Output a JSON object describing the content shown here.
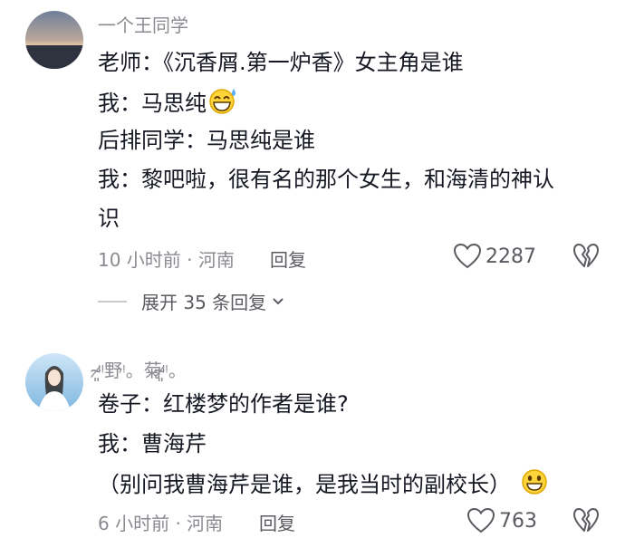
{
  "comments": [
    {
      "username": "一个王同学",
      "lines": [
        "老师：《沉香屑.第一炉香》女主角是谁",
        "我：马思纯",
        "后排同学：马思纯是谁",
        "我：黎吧啦，很有名的那个女生，和海清的神认",
        "识"
      ],
      "meta": "10 小时前 · 河南",
      "reply_label": "回复",
      "likes": "2287",
      "expand_label": "展开 35 条回复"
    },
    {
      "username": "ᵎ̴̷͈ᵎ野ᵎ。菊ᵎ̴̷͈ᵎ。",
      "lines": [
        "卷子：红楼梦的作者是谁?",
        "我：曹海芹",
        "（别问我曹海芹是谁，是我当时的副校长）"
      ],
      "meta": "6 小时前 · 河南",
      "reply_label": "回复",
      "likes": "763"
    }
  ],
  "icons": {
    "like": "heart-outline-icon",
    "dislike": "broken-heart-icon",
    "expand": "chevron-down-icon",
    "emoji1": "grinning-sweat-emoji",
    "emoji2": "grinning-emoji"
  },
  "colors": {
    "text": "#161823",
    "secondary": "#8a8b91",
    "action": "#5a5b61"
  }
}
